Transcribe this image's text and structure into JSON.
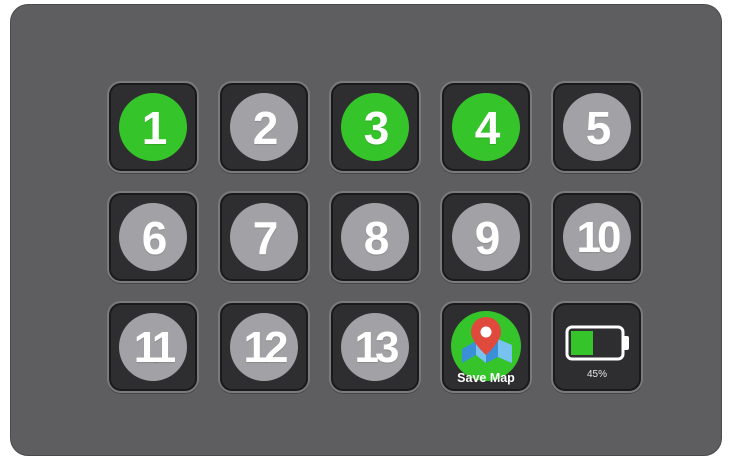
{
  "keys": [
    {
      "label": "1",
      "state": "active"
    },
    {
      "label": "2",
      "state": "inactive"
    },
    {
      "label": "3",
      "state": "active"
    },
    {
      "label": "4",
      "state": "active"
    },
    {
      "label": "5",
      "state": "inactive"
    },
    {
      "label": "6",
      "state": "inactive"
    },
    {
      "label": "7",
      "state": "inactive"
    },
    {
      "label": "8",
      "state": "inactive"
    },
    {
      "label": "9",
      "state": "inactive"
    },
    {
      "label": "10",
      "state": "inactive"
    },
    {
      "label": "11",
      "state": "inactive"
    },
    {
      "label": "12",
      "state": "inactive"
    },
    {
      "label": "13",
      "state": "inactive"
    }
  ],
  "save_map": {
    "label": "Save Map",
    "icon": "map-pin-icon"
  },
  "battery": {
    "percent_text": "45%",
    "level": 0.45,
    "icon": "battery-icon"
  },
  "colors": {
    "active": "#35c52a",
    "inactive": "#a2a2a6",
    "key_bg": "#2e2e30",
    "device_bg": "#5e5e60",
    "pin": "#e04a3c",
    "map": "#4aa3df"
  }
}
